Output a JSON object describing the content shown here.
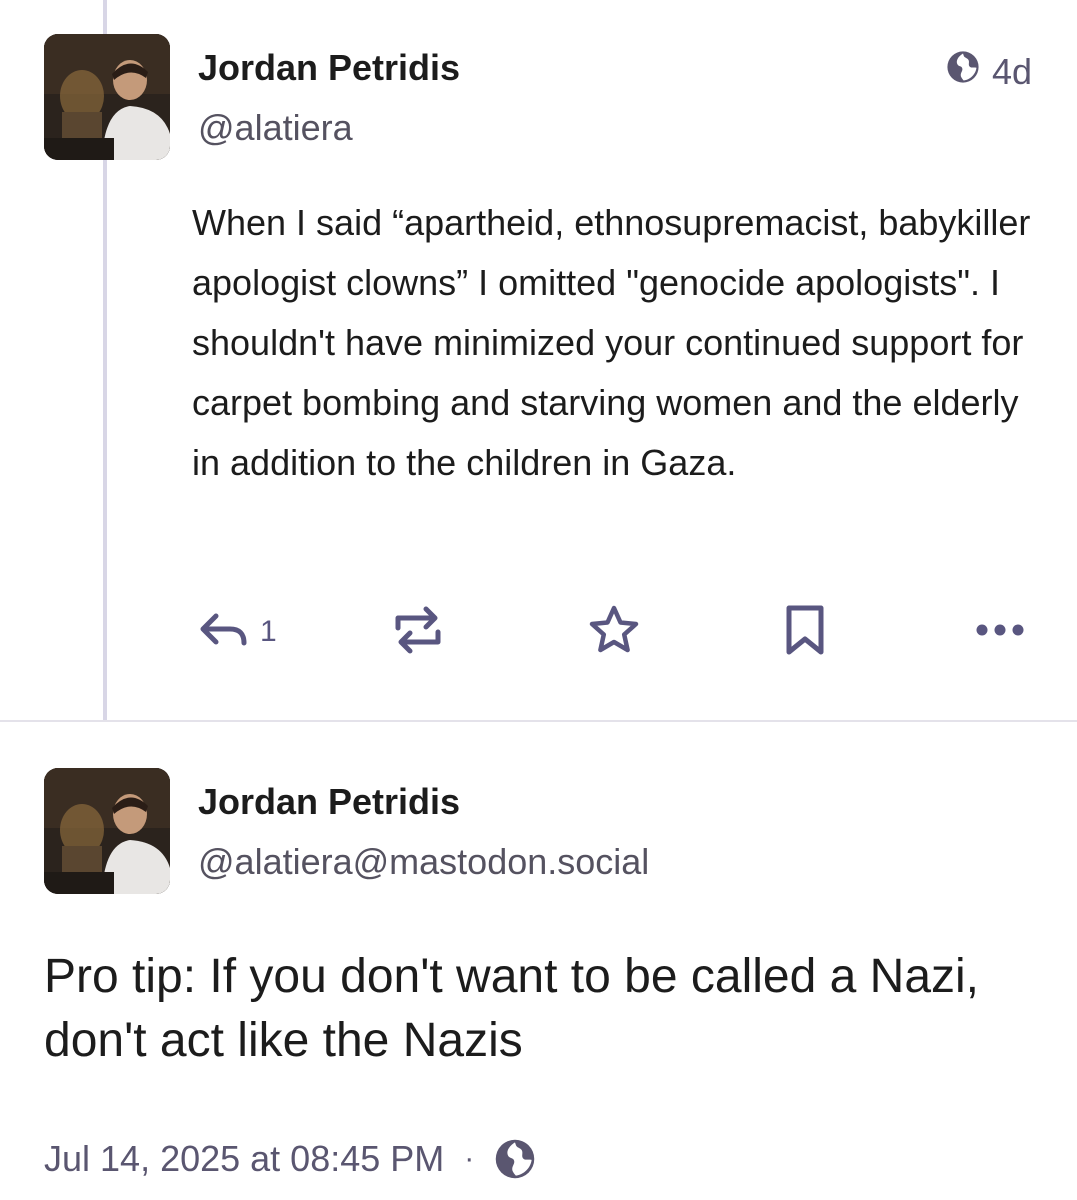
{
  "reply_post": {
    "author_name": "Jordan Petridis",
    "author_handle": "@alatiera",
    "time_ago": "4d",
    "visibility_icon": "globe-icon",
    "text": "When I said “apartheid, ethnosupremacist, babykiller apologist clowns” I omitted \"genocide apologists\". I shouldn't have minimized your continued support for carpet bombing and starving women and the elderly in addition to the children in Gaza.",
    "reply_count": "1",
    "action_icons": [
      "reply-icon",
      "boost-icon",
      "favourite-icon",
      "bookmark-icon",
      "more-icon"
    ]
  },
  "main_post": {
    "author_name": "Jordan Petridis",
    "author_handle": "@alatiera@mastodon.social",
    "text": "Pro tip: If you don't want to be called a Nazi, don't act like the Nazis",
    "timestamp": "Jul 14, 2025 at 08:45 PM",
    "separator": "·",
    "visibility_icon": "globe-icon"
  },
  "colors": {
    "accent": "#595680",
    "thread_line": "#d8d6e6",
    "divider": "#e4e2ea",
    "text": "#1c1c1c",
    "muted": "#5a5670"
  }
}
